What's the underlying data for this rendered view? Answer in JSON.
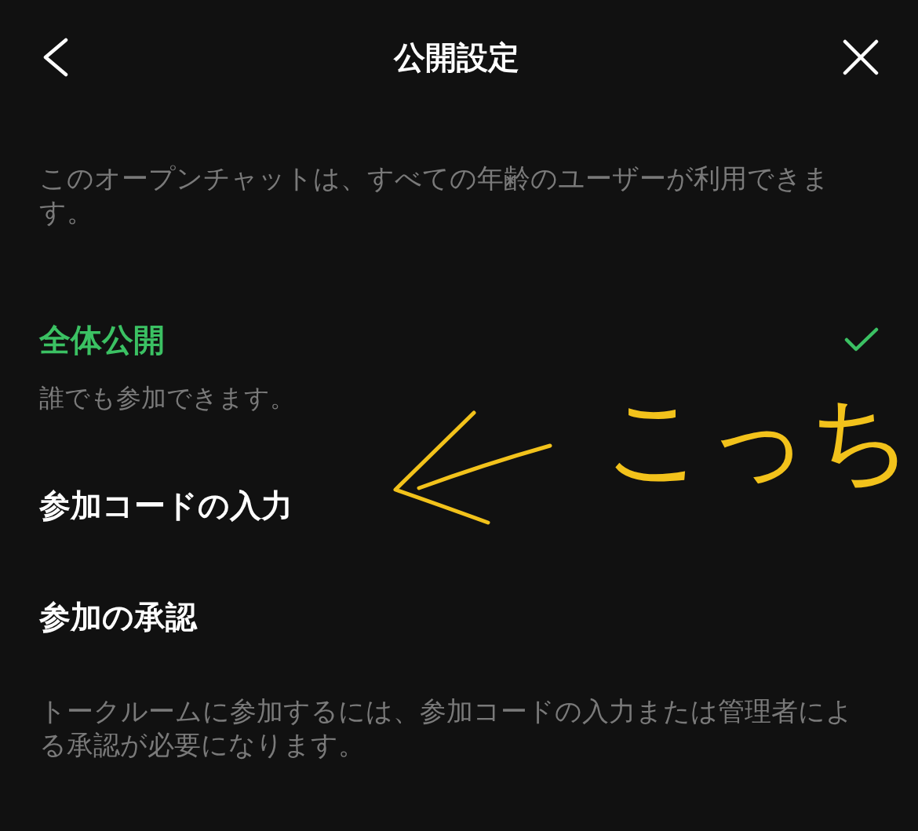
{
  "header": {
    "title": "公開設定"
  },
  "description": "このオープンチャットは、すべての年齢のユーザーが利用できます。",
  "options": [
    {
      "label": "全体公開",
      "subtitle": "誰でも参加できます。",
      "selected": true
    },
    {
      "label": "参加コードの入力",
      "selected": false
    },
    {
      "label": "参加の承認",
      "selected": false
    }
  ],
  "footer_note": "トークルームに参加するには、参加コードの入力または管理者による承認が必要になります。",
  "annotation": {
    "text": "こっち"
  }
}
